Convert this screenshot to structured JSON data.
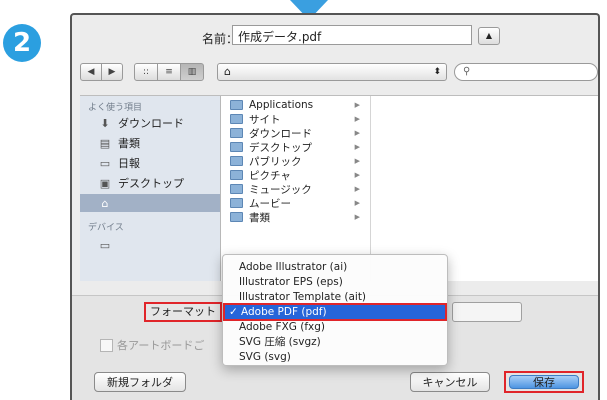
{
  "step_number": "2",
  "dialog": {
    "name_label": "名前：",
    "name_value": "作成データ.pdf",
    "expand_glyph": "▲"
  },
  "toolbar": {
    "back": "◀",
    "forward": "▶",
    "view_icon": "::",
    "view_list": "≡",
    "view_column": "▥",
    "location_icon": "home-icon",
    "location_arrows": "⬍",
    "search_icon": "search-icon"
  },
  "sidebar": {
    "favorites_header": "よく使う項目",
    "items": [
      {
        "label": "ダウンロード",
        "icon": "download-icon"
      },
      {
        "label": "書類",
        "icon": "documents-icon"
      },
      {
        "label": "日報",
        "icon": "folder-icon"
      },
      {
        "label": "デスクトップ",
        "icon": "desktop-icon"
      },
      {
        "label": "",
        "icon": "home-icon",
        "selected": true
      }
    ],
    "devices_header": "デバイス",
    "device_icon": "disk-icon"
  },
  "files": [
    "Applications",
    "サイト",
    "ダウンロード",
    "デスクトップ",
    "パブリック",
    "ピクチャ",
    "ミュージック",
    "ムービー",
    "書類"
  ],
  "options": {
    "format_label": "フォーマット",
    "artboard_label": "各アートボードご"
  },
  "format_menu": {
    "selected_index": 3,
    "items": [
      "Adobe Illustrator (ai)",
      "Illustrator EPS (eps)",
      "Illustrator Template (ait)",
      "Adobe PDF (pdf)",
      "Adobe FXG (fxg)",
      "SVG 圧縮 (svgz)",
      "SVG (svg)"
    ],
    "check_mark": "✓"
  },
  "buttons": {
    "new_folder": "新規フォルダ",
    "cancel": "キャンセル",
    "save": "保存"
  },
  "colors": {
    "badge": "#2b9fe0",
    "highlight": "#e0252a",
    "menu_selected": "#2665d9",
    "save_button": "#4e95e2"
  }
}
